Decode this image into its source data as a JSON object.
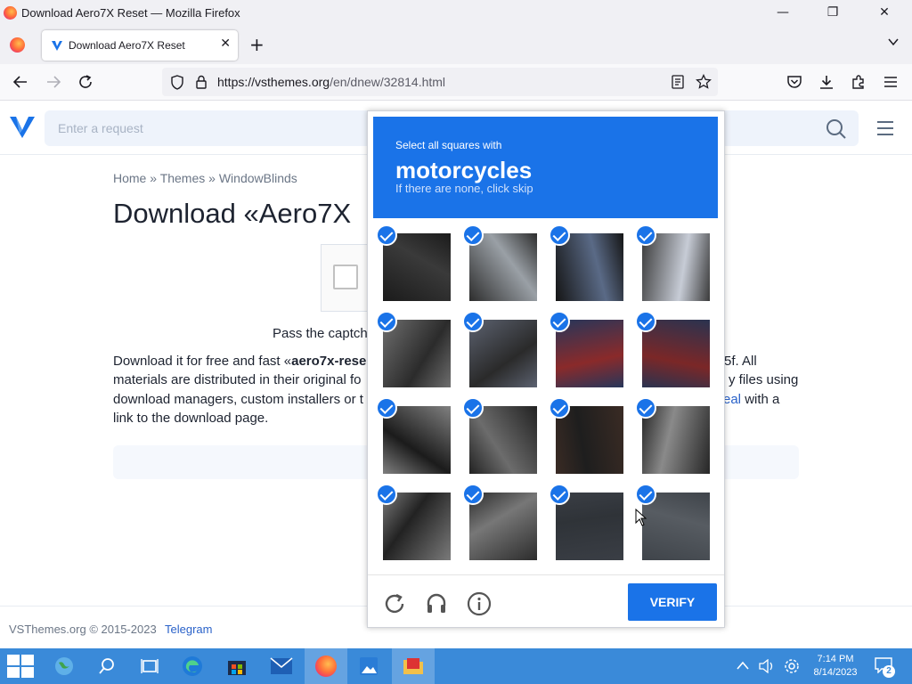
{
  "window": {
    "title": "Download Aero7X Reset — Mozilla Firefox",
    "min": "—",
    "max": "❐",
    "close": "✕"
  },
  "tabs": [
    {
      "label": "Download Aero7X Reset",
      "close": "✕"
    }
  ],
  "toolbar": {
    "new_tab": "+",
    "list_all_tabs": "⌄"
  },
  "nav": {
    "url_host": "https://vsthemes.org",
    "url_path": "/en/dnew/32814.html"
  },
  "site": {
    "search_placeholder": "Enter a request",
    "breadcrumb": [
      "Home",
      "Themes",
      "WindowBlinds"
    ],
    "breadcrumb_sep": "»",
    "page_title": "Download «Aero7X",
    "captcha_prompt": "Pass the captch",
    "body": {
      "line1_pre": "Download it for free and fast «",
      "line1_bold": "aero7x-rese",
      "line1_right": "5f. All",
      "line2_left": "materials are distributed in their original fo",
      "line2_right": "y files using",
      "line3_left": "download managers, custom installers or t",
      "line3_link": "eal",
      "line3_right": " with a",
      "line4": "link to the download page."
    },
    "footer_copyright": "VSThemes.org © 2015-2023",
    "footer_link": "Telegram"
  },
  "captcha": {
    "instruction": "Select all squares with",
    "target": "motorcycles",
    "hint": "If there are none, click skip",
    "verify_label": "VERIFY",
    "tiles_selected": [
      true,
      true,
      true,
      true,
      true,
      true,
      true,
      true,
      true,
      true,
      true,
      true,
      true,
      true,
      true,
      true
    ]
  },
  "taskbar": {
    "time": "7:14 PM",
    "date": "8/14/2023",
    "notifications": "2"
  },
  "colors": {
    "accent": "#1a73e8",
    "taskbar": "#3a8ad9",
    "link": "#2a62c9"
  }
}
